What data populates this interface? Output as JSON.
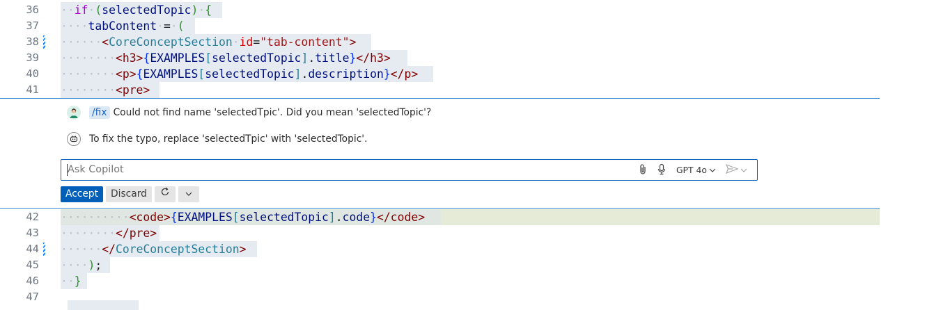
{
  "editor": {
    "top_lines": [
      {
        "number": "36",
        "indent": "··",
        "parts": [
          [
            "kw",
            "if"
          ],
          [
            "dot",
            "·"
          ],
          [
            "par",
            "("
          ],
          [
            "var",
            "selectedTopic"
          ],
          [
            "par",
            ")"
          ],
          [
            "dot",
            "·"
          ],
          [
            "par",
            "{"
          ]
        ]
      },
      {
        "number": "37",
        "indent": "····",
        "parts": [
          [
            "var",
            "tabContent"
          ],
          [
            "dot",
            "·"
          ],
          [
            "",
            "="
          ],
          [
            "dot",
            "·"
          ],
          [
            "par",
            "("
          ]
        ]
      },
      {
        "number": "38",
        "indent": "······",
        "parts": [
          [
            "tag",
            "<"
          ],
          [
            "cmp",
            "CoreConceptSection"
          ],
          [
            "dot",
            "·"
          ],
          [
            "attr",
            "id"
          ],
          [
            "",
            "="
          ],
          [
            "str",
            "\"tab-content\""
          ],
          [
            "tag",
            ">"
          ]
        ]
      },
      {
        "number": "39",
        "indent": "········",
        "parts": [
          [
            "tag",
            "<h3>"
          ],
          [
            "brc",
            "{"
          ],
          [
            "var",
            "EXAMPLES"
          ],
          [
            "cmp",
            "["
          ],
          [
            "var",
            "selectedTopic"
          ],
          [
            "cmp",
            "]"
          ],
          [
            "",
            "."
          ],
          [
            "var",
            "title"
          ],
          [
            "brc",
            "}"
          ],
          [
            "tag",
            "</h3>"
          ]
        ]
      },
      {
        "number": "40",
        "indent": "········",
        "parts": [
          [
            "tag",
            "<p>"
          ],
          [
            "brc",
            "{"
          ],
          [
            "var",
            "EXAMPLES"
          ],
          [
            "cmp",
            "["
          ],
          [
            "var",
            "selectedTopic"
          ],
          [
            "cmp",
            "]"
          ],
          [
            "",
            "."
          ],
          [
            "var",
            "description"
          ],
          [
            "brc",
            "}"
          ],
          [
            "tag",
            "</p>"
          ]
        ]
      },
      {
        "number": "41",
        "indent": "········",
        "parts": [
          [
            "tag",
            "<pre>"
          ]
        ]
      }
    ],
    "bottom_lines": [
      {
        "number": "42",
        "indent": "··········",
        "parts": [
          [
            "tag",
            "<code>"
          ],
          [
            "brc",
            "{"
          ],
          [
            "var",
            "EXAMPLES"
          ],
          [
            "cmp",
            "["
          ],
          [
            "var",
            "selectedTopic"
          ],
          [
            "cmp",
            "]"
          ],
          [
            "",
            "."
          ],
          [
            "var",
            "code"
          ],
          [
            "brc",
            "}"
          ],
          [
            "tag",
            "</code>"
          ]
        ]
      },
      {
        "number": "43",
        "indent": "········",
        "parts": [
          [
            "tag",
            "</pre>"
          ]
        ]
      },
      {
        "number": "44",
        "indent": "······",
        "parts": [
          [
            "tag",
            "</"
          ],
          [
            "cmp",
            "CoreConceptSection"
          ],
          [
            "tag",
            ">"
          ]
        ]
      },
      {
        "number": "45",
        "indent": "····",
        "parts": [
          [
            "par",
            ")"
          ],
          [
            "",
            "; "
          ]
        ]
      },
      {
        "number": "46",
        "indent": "··",
        "parts": [
          [
            "par",
            "}"
          ]
        ]
      },
      {
        "number": "47",
        "indent": "",
        "parts": []
      }
    ]
  },
  "chat": {
    "request_command": "/fix",
    "request_text": "Could not find name 'selectedTpic'. Did you mean 'selectedTopic'?",
    "response_text": "To fix the typo, replace 'selectedTpic' with 'selectedTopic'.",
    "input_placeholder": "Ask Copilot",
    "model_label": "GPT 4o",
    "accept_label": "Accept",
    "discard_label": "Discard",
    "icons": [
      "user-avatar-icon",
      "copilot-icon",
      "paperclip-icon",
      "microphone-icon",
      "chevron-down-icon",
      "send-icon",
      "refresh-icon"
    ]
  },
  "colors": {
    "accent": "#005fb8",
    "border": "#2f86d6",
    "modified_line_bg": "#e5ebf1",
    "added_line_bg": "#e5ebd7"
  }
}
